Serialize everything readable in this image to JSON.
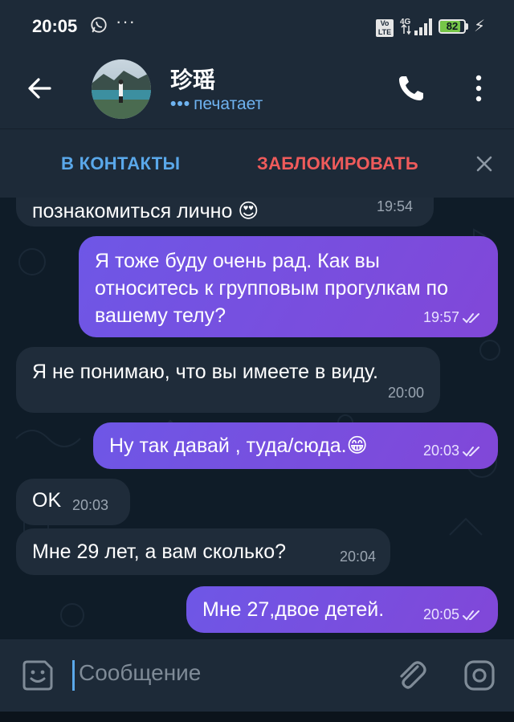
{
  "status_bar": {
    "time": "20:05",
    "volte": "Vo LTE",
    "network": "4G",
    "battery": "82",
    "battery_level": 0.82,
    "icons": [
      "whatsapp-icon",
      "more-dots-icon",
      "volte-icon",
      "signal-icon",
      "battery-icon",
      "charging-icon"
    ]
  },
  "header": {
    "name": "珍瑶",
    "status": "печатает",
    "status_dots": "•••",
    "icons": [
      "back-arrow-icon",
      "phone-icon",
      "more-vertical-icon"
    ]
  },
  "action_bar": {
    "add_contact": "В КОНТАКТЫ",
    "block": "ЗАБЛОКИРОВАТЬ",
    "close_icon": "close-icon"
  },
  "messages": [
    {
      "direction": "in",
      "text": "познакомиться лично 😍",
      "time": "19:54"
    },
    {
      "direction": "out",
      "text": "Я тоже буду очень рад. Как вы относитесь к групповым прогулкам по вашему телу?",
      "time": "19:57",
      "read": true
    },
    {
      "direction": "in",
      "text": "Я не понимаю, что вы имеете в виду.",
      "time": "20:00"
    },
    {
      "direction": "out",
      "text": "Ну так давай , туда/сюда.😁",
      "time": "20:03",
      "read": true
    },
    {
      "direction": "in",
      "text": "OK",
      "time": "20:03"
    },
    {
      "direction": "in",
      "text": "Мне 29 лет, а вам сколько?",
      "time": "20:04"
    },
    {
      "direction": "out",
      "text": "Мне 27,двое детей.",
      "time": "20:05",
      "read": true
    }
  ],
  "input": {
    "placeholder": "Сообщение",
    "icons": [
      "emoji-sticker-icon",
      "attach-icon",
      "camera-icon"
    ]
  },
  "colors": {
    "background": "#0f1c28",
    "header": "#1d2a38",
    "incoming_bubble": "#1f2c3a",
    "outgoing_bubble": "#7c4ddb",
    "accent_blue": "#5aa8ea",
    "danger_red": "#ef5b5b"
  }
}
